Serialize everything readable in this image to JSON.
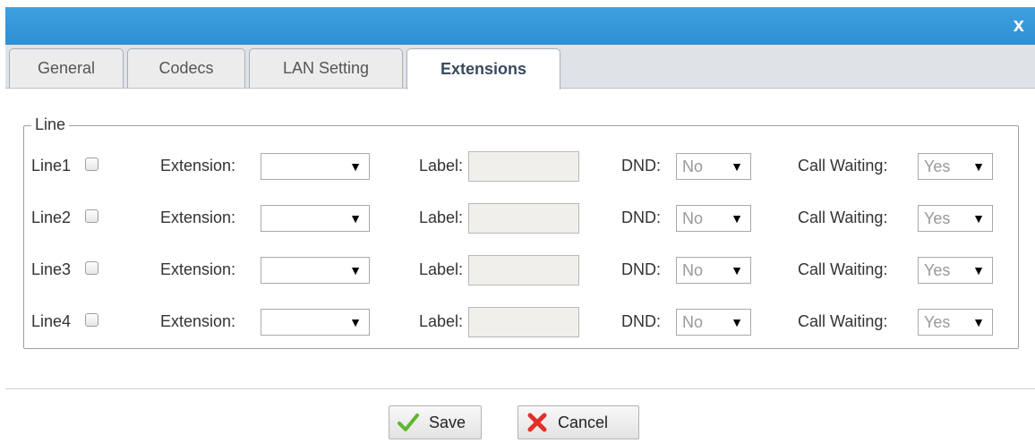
{
  "dialog": {
    "close_label": "x"
  },
  "tabs": [
    {
      "label": "General",
      "active": false
    },
    {
      "label": "Codecs",
      "active": false
    },
    {
      "label": "LAN Setting",
      "active": false
    },
    {
      "label": "Extensions",
      "active": true
    }
  ],
  "fieldset": {
    "legend": "Line"
  },
  "labels": {
    "extension": "Extension:",
    "label": "Label:",
    "dnd": "DND:",
    "call_waiting": "Call Waiting:"
  },
  "lines": [
    {
      "name": "Line1",
      "checked": false,
      "extension": "",
      "label": "",
      "dnd": "No",
      "call_waiting": "Yes"
    },
    {
      "name": "Line2",
      "checked": false,
      "extension": "",
      "label": "",
      "dnd": "No",
      "call_waiting": "Yes"
    },
    {
      "name": "Line3",
      "checked": false,
      "extension": "",
      "label": "",
      "dnd": "No",
      "call_waiting": "Yes"
    },
    {
      "name": "Line4",
      "checked": false,
      "extension": "",
      "label": "",
      "dnd": "No",
      "call_waiting": "Yes"
    }
  ],
  "buttons": {
    "save": "Save",
    "cancel": "Cancel"
  },
  "colors": {
    "titlebar": "#3fa0de",
    "save_icon": "#5cb82b",
    "cancel_icon": "#e0302a"
  }
}
